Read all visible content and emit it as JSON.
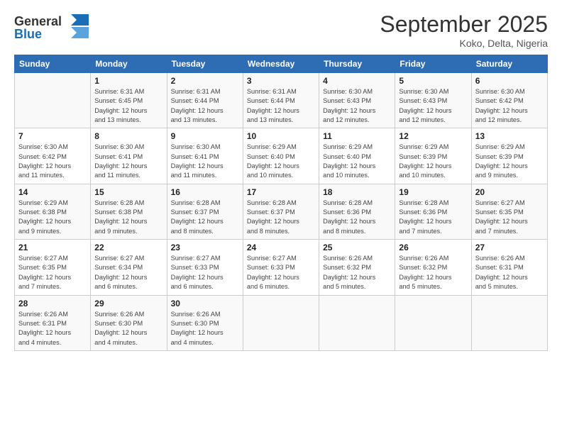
{
  "header": {
    "logo_line1": "General",
    "logo_line2": "Blue",
    "month": "September 2025",
    "location": "Koko, Delta, Nigeria"
  },
  "days_of_week": [
    "Sunday",
    "Monday",
    "Tuesday",
    "Wednesday",
    "Thursday",
    "Friday",
    "Saturday"
  ],
  "weeks": [
    [
      {
        "num": "",
        "info": ""
      },
      {
        "num": "1",
        "info": "Sunrise: 6:31 AM\nSunset: 6:45 PM\nDaylight: 12 hours\nand 13 minutes."
      },
      {
        "num": "2",
        "info": "Sunrise: 6:31 AM\nSunset: 6:44 PM\nDaylight: 12 hours\nand 13 minutes."
      },
      {
        "num": "3",
        "info": "Sunrise: 6:31 AM\nSunset: 6:44 PM\nDaylight: 12 hours\nand 13 minutes."
      },
      {
        "num": "4",
        "info": "Sunrise: 6:30 AM\nSunset: 6:43 PM\nDaylight: 12 hours\nand 12 minutes."
      },
      {
        "num": "5",
        "info": "Sunrise: 6:30 AM\nSunset: 6:43 PM\nDaylight: 12 hours\nand 12 minutes."
      },
      {
        "num": "6",
        "info": "Sunrise: 6:30 AM\nSunset: 6:42 PM\nDaylight: 12 hours\nand 12 minutes."
      }
    ],
    [
      {
        "num": "7",
        "info": "Sunrise: 6:30 AM\nSunset: 6:42 PM\nDaylight: 12 hours\nand 11 minutes."
      },
      {
        "num": "8",
        "info": "Sunrise: 6:30 AM\nSunset: 6:41 PM\nDaylight: 12 hours\nand 11 minutes."
      },
      {
        "num": "9",
        "info": "Sunrise: 6:30 AM\nSunset: 6:41 PM\nDaylight: 12 hours\nand 11 minutes."
      },
      {
        "num": "10",
        "info": "Sunrise: 6:29 AM\nSunset: 6:40 PM\nDaylight: 12 hours\nand 10 minutes."
      },
      {
        "num": "11",
        "info": "Sunrise: 6:29 AM\nSunset: 6:40 PM\nDaylight: 12 hours\nand 10 minutes."
      },
      {
        "num": "12",
        "info": "Sunrise: 6:29 AM\nSunset: 6:39 PM\nDaylight: 12 hours\nand 10 minutes."
      },
      {
        "num": "13",
        "info": "Sunrise: 6:29 AM\nSunset: 6:39 PM\nDaylight: 12 hours\nand 9 minutes."
      }
    ],
    [
      {
        "num": "14",
        "info": "Sunrise: 6:29 AM\nSunset: 6:38 PM\nDaylight: 12 hours\nand 9 minutes."
      },
      {
        "num": "15",
        "info": "Sunrise: 6:28 AM\nSunset: 6:38 PM\nDaylight: 12 hours\nand 9 minutes."
      },
      {
        "num": "16",
        "info": "Sunrise: 6:28 AM\nSunset: 6:37 PM\nDaylight: 12 hours\nand 8 minutes."
      },
      {
        "num": "17",
        "info": "Sunrise: 6:28 AM\nSunset: 6:37 PM\nDaylight: 12 hours\nand 8 minutes."
      },
      {
        "num": "18",
        "info": "Sunrise: 6:28 AM\nSunset: 6:36 PM\nDaylight: 12 hours\nand 8 minutes."
      },
      {
        "num": "19",
        "info": "Sunrise: 6:28 AM\nSunset: 6:36 PM\nDaylight: 12 hours\nand 7 minutes."
      },
      {
        "num": "20",
        "info": "Sunrise: 6:27 AM\nSunset: 6:35 PM\nDaylight: 12 hours\nand 7 minutes."
      }
    ],
    [
      {
        "num": "21",
        "info": "Sunrise: 6:27 AM\nSunset: 6:35 PM\nDaylight: 12 hours\nand 7 minutes."
      },
      {
        "num": "22",
        "info": "Sunrise: 6:27 AM\nSunset: 6:34 PM\nDaylight: 12 hours\nand 6 minutes."
      },
      {
        "num": "23",
        "info": "Sunrise: 6:27 AM\nSunset: 6:33 PM\nDaylight: 12 hours\nand 6 minutes."
      },
      {
        "num": "24",
        "info": "Sunrise: 6:27 AM\nSunset: 6:33 PM\nDaylight: 12 hours\nand 6 minutes."
      },
      {
        "num": "25",
        "info": "Sunrise: 6:26 AM\nSunset: 6:32 PM\nDaylight: 12 hours\nand 5 minutes."
      },
      {
        "num": "26",
        "info": "Sunrise: 6:26 AM\nSunset: 6:32 PM\nDaylight: 12 hours\nand 5 minutes."
      },
      {
        "num": "27",
        "info": "Sunrise: 6:26 AM\nSunset: 6:31 PM\nDaylight: 12 hours\nand 5 minutes."
      }
    ],
    [
      {
        "num": "28",
        "info": "Sunrise: 6:26 AM\nSunset: 6:31 PM\nDaylight: 12 hours\nand 4 minutes."
      },
      {
        "num": "29",
        "info": "Sunrise: 6:26 AM\nSunset: 6:30 PM\nDaylight: 12 hours\nand 4 minutes."
      },
      {
        "num": "30",
        "info": "Sunrise: 6:26 AM\nSunset: 6:30 PM\nDaylight: 12 hours\nand 4 minutes."
      },
      {
        "num": "",
        "info": ""
      },
      {
        "num": "",
        "info": ""
      },
      {
        "num": "",
        "info": ""
      },
      {
        "num": "",
        "info": ""
      }
    ]
  ]
}
